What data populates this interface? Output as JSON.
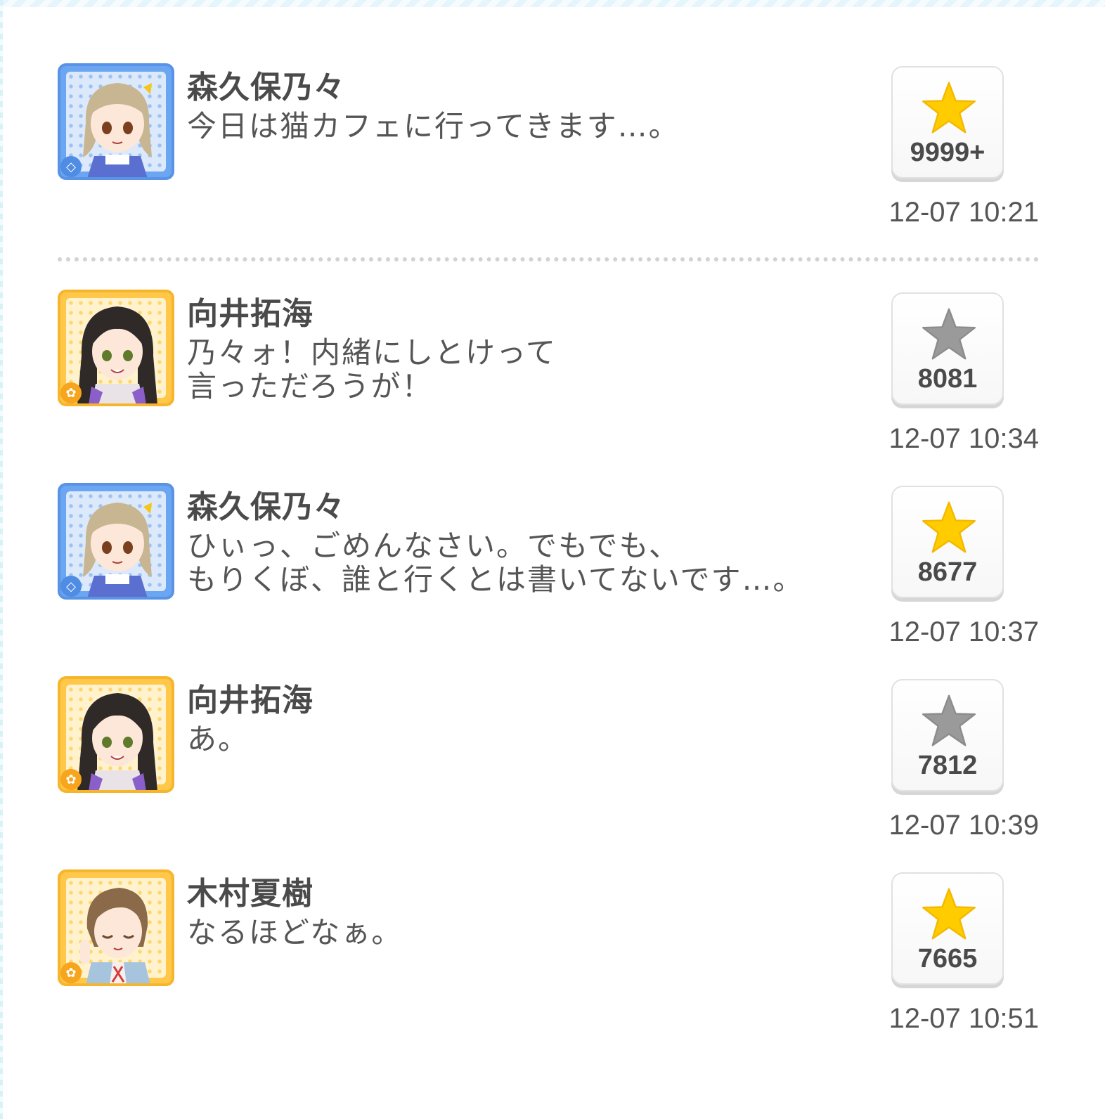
{
  "theme": {
    "star_active_color": "#ffcc00",
    "star_inactive_color": "#9a9a9a",
    "cool_frame_color": "#5a93e6",
    "passion_frame_color": "#f7b52c"
  },
  "posts": [
    {
      "author": "森久保乃々",
      "message": "今日は猫カフェに行ってきます…。",
      "likes": "9999+",
      "liked": true,
      "timestamp": "12-07 10:21",
      "avatar_type": "cool",
      "badge_icon": "gem-icon"
    },
    {
      "author": "向井拓海",
      "message": "乃々ォ！内緒にしとけって\n言っただろうが！",
      "likes": "8081",
      "liked": false,
      "timestamp": "12-07 10:34",
      "avatar_type": "passion",
      "badge_icon": "flower-icon"
    },
    {
      "author": "森久保乃々",
      "message": "ひぃっ、ごめんなさい。でもでも、\nもりくぼ、誰と行くとは書いてないです…。",
      "likes": "8677",
      "liked": true,
      "timestamp": "12-07 10:37",
      "avatar_type": "cool",
      "badge_icon": "gem-icon"
    },
    {
      "author": "向井拓海",
      "message": "あ。",
      "likes": "7812",
      "liked": false,
      "timestamp": "12-07 10:39",
      "avatar_type": "passion",
      "badge_icon": "flower-icon"
    },
    {
      "author": "木村夏樹",
      "message": "なるほどなぁ。",
      "likes": "7665",
      "liked": true,
      "timestamp": "12-07 10:51",
      "avatar_type": "passion",
      "badge_icon": "flower-icon"
    }
  ]
}
